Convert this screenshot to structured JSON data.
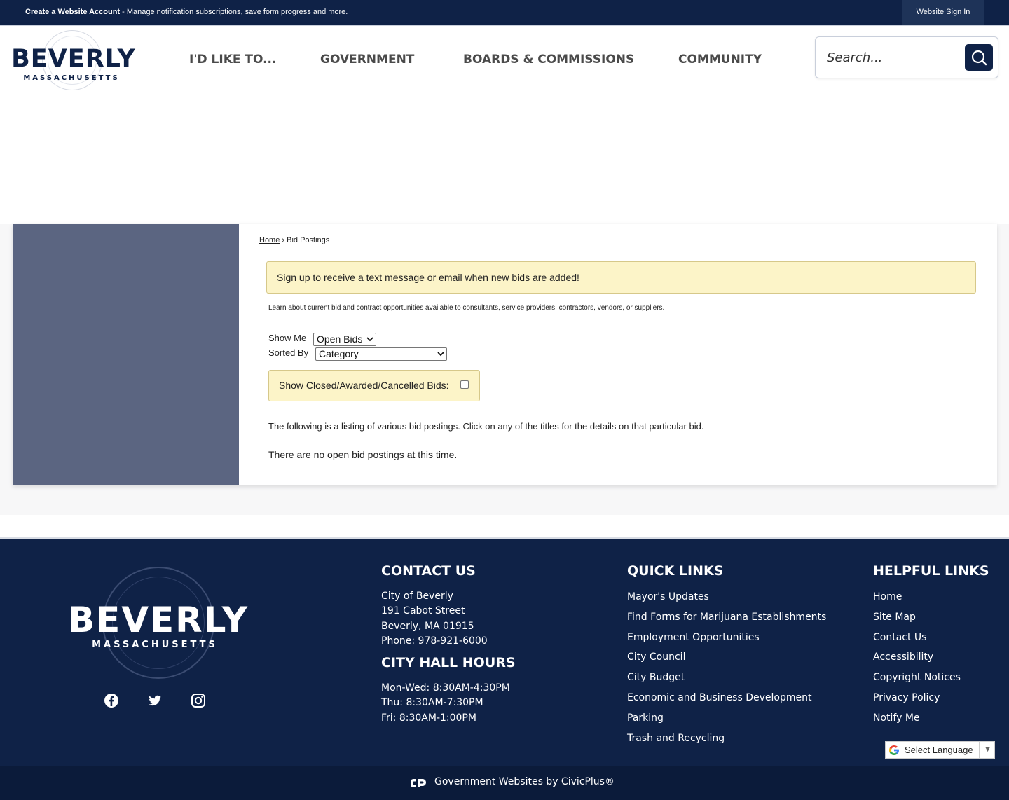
{
  "topbar": {
    "create_account": "Create a Website Account",
    "message": " - Manage notification subscriptions, save form progress and more.",
    "sign_in": "Website Sign In"
  },
  "header": {
    "logo_word": "BEVERLY",
    "logo_sub": "MASSACHUSETTS",
    "nav": [
      "I'D LIKE TO...",
      "GOVERNMENT",
      "BOARDS & COMMISSIONS",
      "COMMUNITY"
    ],
    "search_placeholder": "Search..."
  },
  "breadcrumb": {
    "home": "Home",
    "separator": " › ",
    "current": "Bid Postings"
  },
  "alert": {
    "link": "Sign up",
    "text": " to receive a text message or email when new bids are added!"
  },
  "intro": "Learn about current bid and contract opportunities available to consultants, service providers, contractors, vendors, or suppliers.",
  "filters": {
    "show_me_label": "Show Me",
    "show_me_value": "Open Bids",
    "sorted_by_label": "Sorted By",
    "sorted_by_value": "Category",
    "closed_label": "Show Closed/Awarded/Cancelled Bids:"
  },
  "listing_text": "The following is a listing of various bid postings. Click on any of the titles for the details on that particular bid.",
  "no_postings": "There are no open bid postings at this time.",
  "footer": {
    "logo_word": "BEVERLY",
    "logo_sub": "MASSACHUSETTS",
    "contact": {
      "heading": "CONTACT US",
      "lines": [
        "City of Beverly",
        "191 Cabot Street",
        "Beverly, MA 01915",
        "Phone: 978-921-6000"
      ]
    },
    "hours": {
      "heading": "CITY HALL HOURS",
      "lines": [
        "Mon-Wed: 8:30AM-4:30PM",
        "Thu: 8:30AM-7:30PM",
        "Fri: 8:30AM-1:00PM"
      ]
    },
    "quick_links": {
      "heading": "QUICK LINKS",
      "items": [
        "Mayor's Updates",
        "Find Forms for Marijuana Establishments",
        "Employment Opportunities",
        "City Council",
        "City Budget",
        "Economic and Business Development",
        "Parking",
        "Trash and Recycling"
      ]
    },
    "helpful_links": {
      "heading": "HELPFUL LINKS",
      "items": [
        "Home",
        "Site Map",
        "Contact Us",
        "Accessibility",
        "Copyright Notices",
        "Privacy Policy",
        "Notify Me"
      ]
    },
    "social_icons": [
      "facebook-icon",
      "twitter-icon",
      "instagram-icon"
    ],
    "language": "Select Language",
    "language_arrow": "▼",
    "credit": "Government Websites by CivicPlus®"
  },
  "colors": {
    "navy": "#0f2247",
    "sidebar": "#5b6581",
    "alert_bg": "#fcf4c8"
  }
}
